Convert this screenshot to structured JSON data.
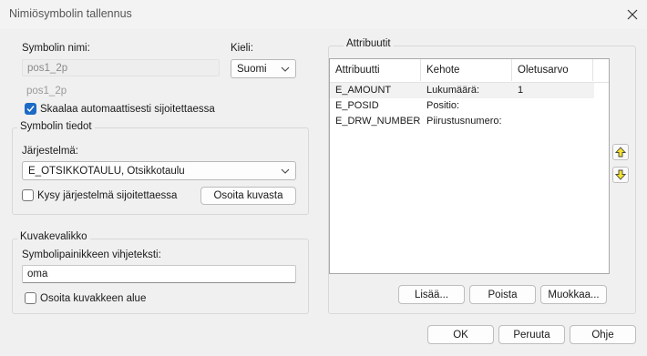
{
  "window": {
    "title": "Nimiösymbolin tallennus"
  },
  "symbol": {
    "name_label": "Symbolin nimi:",
    "name_value": "pos1_2p",
    "name_secondary": "pos1_2p",
    "language_label": "Kieli:",
    "language_value": "Suomi",
    "scale_checkbox_label": "Skaalaa automaattisesti sijoitettaessa",
    "scale_checked": true
  },
  "symbol_info": {
    "group_title": "Symbolin tiedot",
    "system_label": "Järjestelmä:",
    "system_value": "E_OTSIKKOTAULU, Otsikkotaulu",
    "ask_system_label": "Kysy järjestelmä sijoitettaessa",
    "ask_system_checked": false,
    "pick_from_image_button": "Osoita kuvasta"
  },
  "image_menu": {
    "group_title": "Kuvakevalikko",
    "hint_label": "Symbolipainikkeen vihjeteksti:",
    "hint_value": "oma",
    "pick_area_label": "Osoita kuvakkeen alue",
    "pick_area_checked": false
  },
  "attributes": {
    "group_title": "Attribuutit",
    "columns": [
      "Attribuutti",
      "Kehote",
      "Oletusarvo"
    ],
    "rows": [
      [
        "E_AMOUNT",
        "Lukumäärä:",
        "1"
      ],
      [
        "E_POSID",
        "Positio:",
        ""
      ],
      [
        "E_DRW_NUMBER",
        "Piirustusnumero:",
        ""
      ]
    ],
    "add_button": "Lisää...",
    "remove_button": "Poista",
    "edit_button": "Muokkaa..."
  },
  "footer": {
    "ok_button": "OK",
    "cancel_button": "Peruuta",
    "help_button": "Ohje"
  },
  "colors": {
    "accent": "#1c6ac5",
    "arrow_yellow": "#f5e32a"
  }
}
